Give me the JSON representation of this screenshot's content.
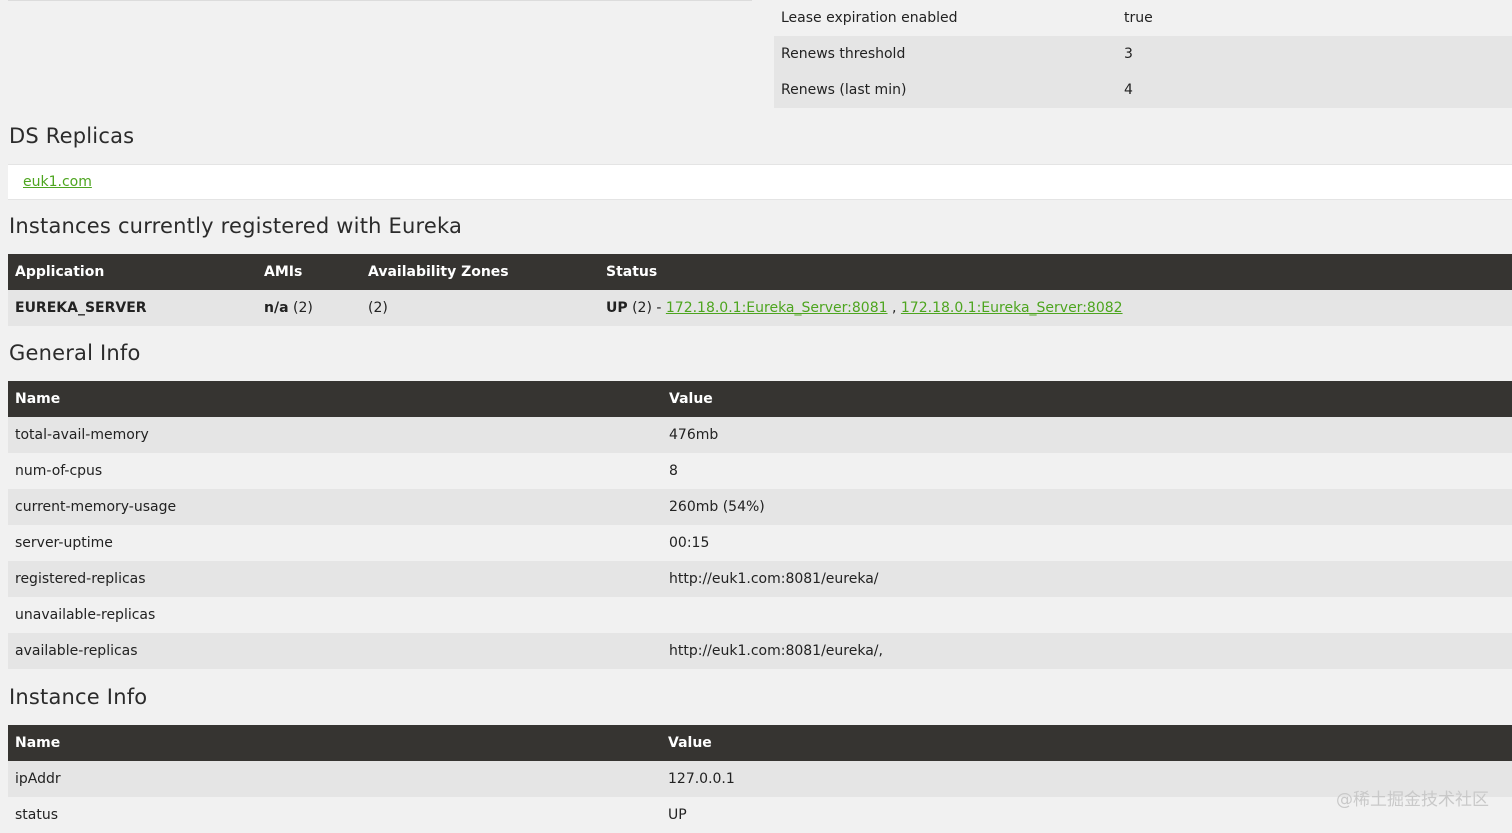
{
  "lease_table": [
    {
      "name": "Lease expiration enabled",
      "value": "true"
    },
    {
      "name": "Renews threshold",
      "value": "3"
    },
    {
      "name": "Renews (last min)",
      "value": "4"
    }
  ],
  "ds_replicas": {
    "title": "DS Replicas",
    "link": "euk1.com"
  },
  "instances": {
    "title": "Instances currently registered with Eureka",
    "headers": [
      "Application",
      "AMIs",
      "Availability Zones",
      "Status"
    ],
    "row": {
      "application": "EUREKA_SERVER",
      "amis_bold": "n/a",
      "amis_count": " (2)",
      "zones": "(2)",
      "status_bold": "UP",
      "status_count": " (2) - ",
      "link1": "172.18.0.1:Eureka_Server:8081",
      "sep": " , ",
      "link2": "172.18.0.1:Eureka_Server:8082"
    }
  },
  "general_info": {
    "title": "General Info",
    "headers": [
      "Name",
      "Value"
    ],
    "rows": [
      {
        "name": "total-avail-memory",
        "value": "476mb"
      },
      {
        "name": "num-of-cpus",
        "value": "8"
      },
      {
        "name": "current-memory-usage",
        "value": "260mb (54%)"
      },
      {
        "name": "server-uptime",
        "value": "00:15"
      },
      {
        "name": "registered-replicas",
        "value": "http://euk1.com:8081/eureka/"
      },
      {
        "name": "unavailable-replicas",
        "value": ""
      },
      {
        "name": "available-replicas",
        "value": "http://euk1.com:8081/eureka/,"
      }
    ]
  },
  "instance_info": {
    "title": "Instance Info",
    "headers": [
      "Name",
      "Value"
    ],
    "rows": [
      {
        "name": "ipAddr",
        "value": "127.0.0.1"
      },
      {
        "name": "status",
        "value": "UP"
      }
    ]
  },
  "watermark": "@稀土掘金技术社区"
}
